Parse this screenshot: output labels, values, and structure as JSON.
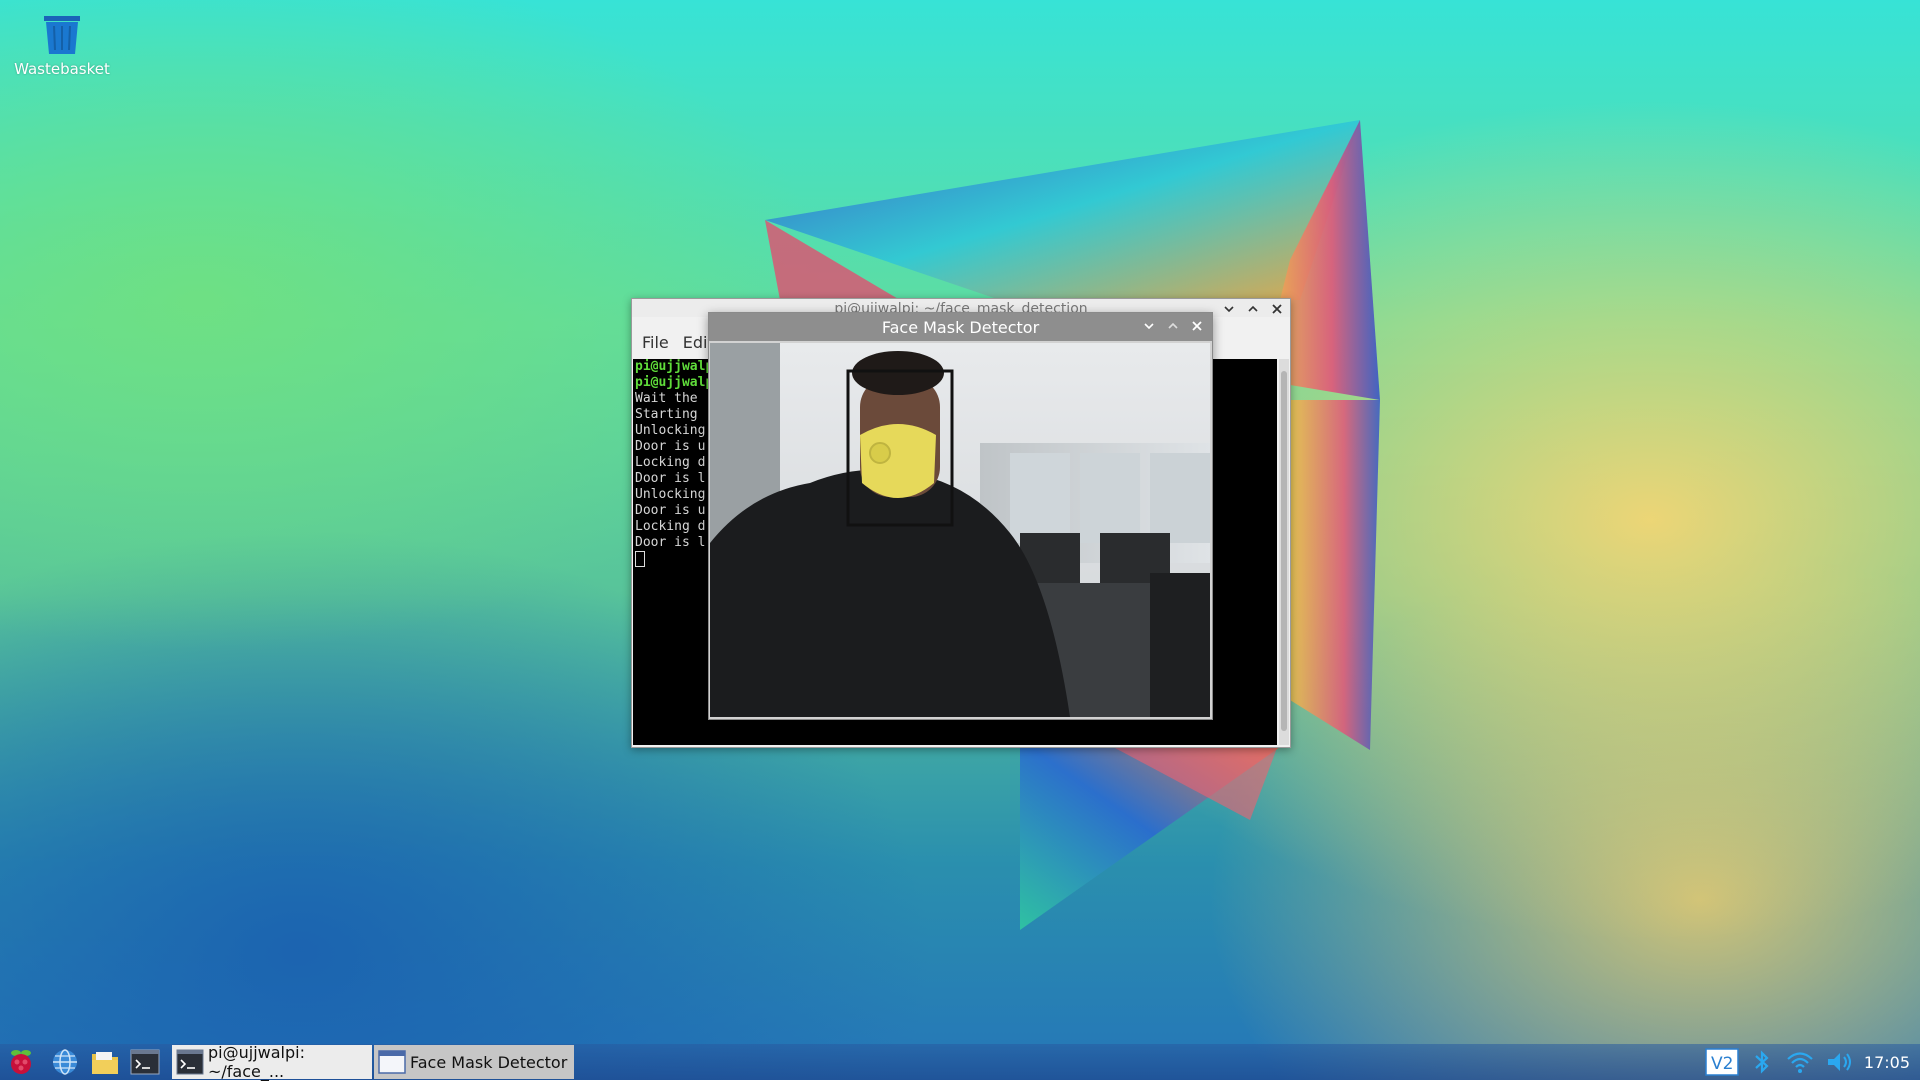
{
  "desktop": {
    "icons": [
      {
        "label": "Wastebasket",
        "icon": "trash-bin-icon"
      }
    ]
  },
  "terminal": {
    "title": "pi@ujjwalpi: ~/face_mask_detection",
    "menu": [
      "File",
      "Edit"
    ],
    "lines": [
      {
        "text": "pi@ujjwalp",
        "prompt": true
      },
      {
        "text": "pi@ujjwalp",
        "prompt": true
      },
      {
        "text": "Wait the ",
        "prompt": false
      },
      {
        "text": "Starting ",
        "prompt": false
      },
      {
        "text": "Unlocking",
        "prompt": false
      },
      {
        "text": "Door is u",
        "prompt": false
      },
      {
        "text": "Locking d",
        "prompt": false
      },
      {
        "text": "Door is l",
        "prompt": false
      },
      {
        "text": "Unlocking",
        "prompt": false
      },
      {
        "text": "Door is u",
        "prompt": false
      },
      {
        "text": "Locking d",
        "prompt": false
      },
      {
        "text": "Door is l",
        "prompt": false
      }
    ],
    "window_buttons": [
      "minimize",
      "maximize",
      "close"
    ]
  },
  "face_mask_detector": {
    "title": "Face Mask Detector",
    "window_buttons": [
      "minimize",
      "maximize",
      "close"
    ]
  },
  "taskbar": {
    "launchers": [
      "raspberry-menu-icon",
      "web-browser-icon",
      "file-manager-icon",
      "terminal-icon"
    ],
    "tasks": [
      {
        "label": "pi@ujjwalpi: ~/face_...",
        "icon": "terminal-icon",
        "active": false
      },
      {
        "label": "Face Mask Detector",
        "icon": "window-icon",
        "active": true
      }
    ],
    "tray": [
      "vnc-icon",
      "bluetooth-icon",
      "wifi-icon",
      "volume-icon"
    ],
    "clock": "17:05"
  },
  "colors": {
    "prompt_green": "#5fdc3a",
    "detector_titlebar": "#8e8e8e",
    "terminal_bg": "#000000"
  }
}
